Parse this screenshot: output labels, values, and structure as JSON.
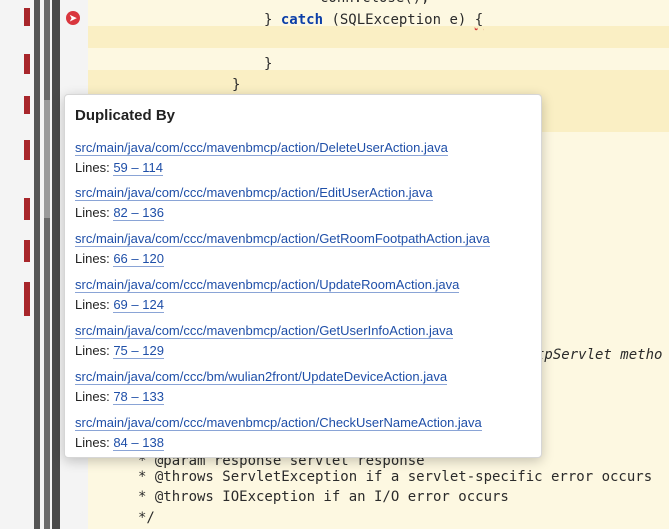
{
  "code_lines": [
    {
      "text": "conn.close();",
      "style": "plain"
    },
    {
      "pre": "} ",
      "kw": "catch",
      "post": " (SQLException e) ",
      "err": "{"
    },
    {
      "text": "}",
      "style": "plain"
    },
    {
      "text": "}",
      "style": "plain"
    },
    {
      "text": "tpServlet metho",
      "style": "italic"
    },
    {
      "text": "* @param response servlet response",
      "style": "plain"
    },
    {
      "text": "* @throws ServletException if a servlet-specific error occurs",
      "style": "plain"
    },
    {
      "text": "* @throws IOException if an I/O error occurs",
      "style": "plain"
    },
    {
      "text": "*/",
      "style": "plain"
    }
  ],
  "popup": {
    "title": "Duplicated By",
    "lines_label": "Lines:",
    "entries": [
      {
        "path": "src/main/java/com/ccc/mavenbmcp/action/DeleteUserAction.java",
        "lines": "59 – 114"
      },
      {
        "path": "src/main/java/com/ccc/mavenbmcp/action/EditUserAction.java",
        "lines": "82 – 136"
      },
      {
        "path": "src/main/java/com/ccc/mavenbmcp/action/GetRoomFootpathAction.java",
        "lines": "66 – 120"
      },
      {
        "path": "src/main/java/com/ccc/mavenbmcp/action/UpdateRoomAction.java",
        "lines": "69 – 124"
      },
      {
        "path": "src/main/java/com/ccc/mavenbmcp/action/GetUserInfoAction.java",
        "lines": "75 – 129"
      },
      {
        "path": "src/main/java/com/ccc/bm/wulian2front/UpdateDeviceAction.java",
        "lines": "78 – 133"
      },
      {
        "path": "src/main/java/com/ccc/mavenbmcp/action/CheckUserNameAction.java",
        "lines": "84 – 138"
      }
    ]
  },
  "colors": {
    "duplication_marker": "#a8262b",
    "code_background": "#fdf8e1",
    "highlight_line": "#faefc4",
    "keyword": "#0b3ea8",
    "link": "#1f4fa8",
    "error_icon": "#d9363e"
  },
  "icons": {
    "gutter_error": "error-collapse-icon"
  }
}
